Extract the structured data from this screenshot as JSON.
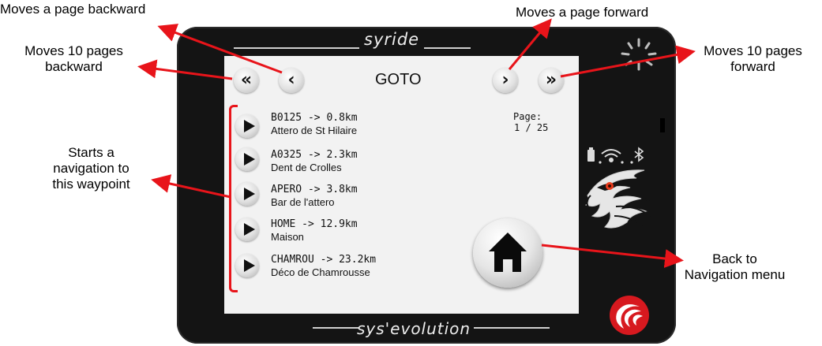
{
  "annotations": {
    "page_backward": "Moves a page backward",
    "page_forward": "Moves a page forward",
    "ten_backward_line1": "Moves 10 pages",
    "ten_backward_line2": "backward",
    "ten_forward_line1": "Moves 10 pages",
    "ten_forward_line2": "forward",
    "start_nav_line1": "Starts a",
    "start_nav_line2": "navigation to",
    "start_nav_line3": "this waypoint",
    "back_line1": "Back to",
    "back_line2": "Navigation menu"
  },
  "device": {
    "brand_top": "syride",
    "brand_bottom": "sys'evolution"
  },
  "screen": {
    "title": "GOTO",
    "page_label": "Page:",
    "page_value": "1 / 25",
    "nav": {
      "ten_back": "«",
      "back": "‹",
      "forward": "›",
      "ten_forward": "»"
    },
    "waypoints": [
      {
        "title": "B0125 -> 0.8km",
        "subtitle": "Attero de St Hilaire"
      },
      {
        "title": "A0325 -> 2.3km",
        "subtitle": "Dent de Crolles"
      },
      {
        "title": "APERO -> 3.8km",
        "subtitle": "Bar de l'attero"
      },
      {
        "title": "HOME -> 12.9km",
        "subtitle": "Maison"
      },
      {
        "title": "CHAMROU -> 23.2km",
        "subtitle": "Déco de Chamrousse"
      }
    ]
  },
  "colors": {
    "annotation_arrow": "#e8141a",
    "device_body": "#141414",
    "screen_bg": "#f2f2f2",
    "eye": "#e83a1a"
  },
  "icons": {
    "home": "home-icon",
    "status": [
      "battery-icon",
      "wifi-icon",
      "bluetooth-icon"
    ],
    "eagle_logo": "eagle-logo",
    "brand_logo": "syride-swirl-logo",
    "light_sensor": "sunburst-icon"
  }
}
